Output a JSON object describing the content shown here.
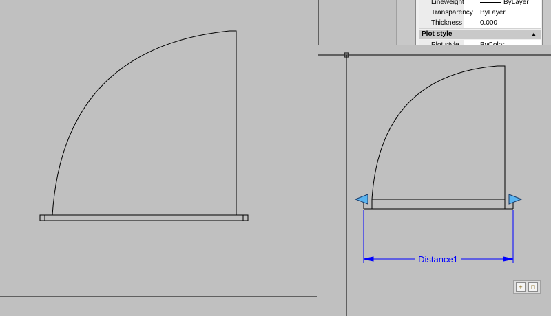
{
  "properties": {
    "rows": [
      {
        "name": "Lineweight",
        "value": "ByLayer",
        "has_line": true
      },
      {
        "name": "Transparency",
        "value": "ByLayer",
        "has_line": false
      },
      {
        "name": "Thickness",
        "value": "0.000",
        "has_line": false
      }
    ],
    "section_title": "Plot style",
    "section_row": {
      "name": "Plot style",
      "value": "ByColor"
    }
  },
  "drawing": {
    "dimension_label": "Distance1"
  },
  "colors": {
    "background": "#c0c0c0",
    "line": "#000000",
    "dimension": "#0000ff",
    "grip": "#5ab4f0"
  },
  "icons": [
    "collapse-chevron-icon",
    "zoom-icon",
    "pan-icon"
  ]
}
